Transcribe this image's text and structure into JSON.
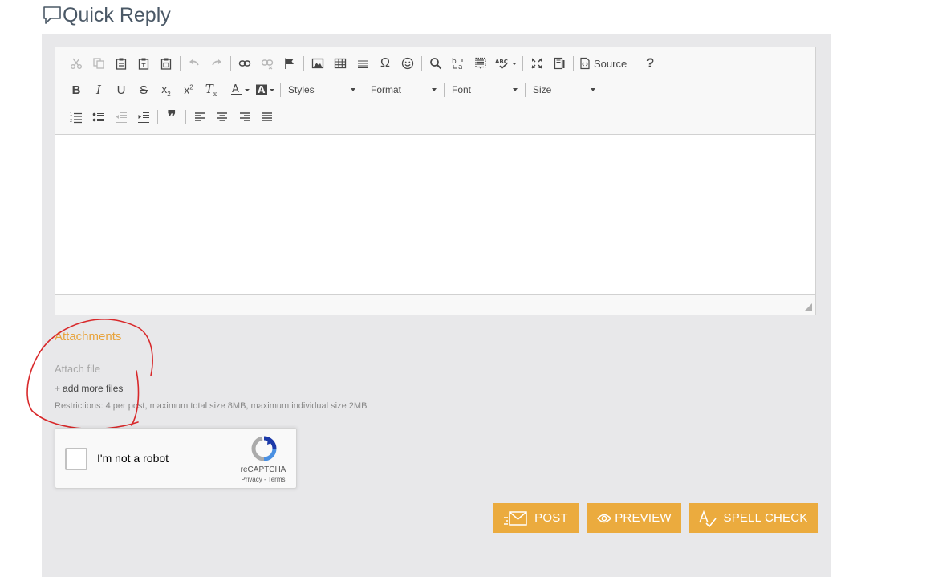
{
  "header": {
    "title": "Quick Reply",
    "icon": "speech-bubble-icon"
  },
  "toolbar": {
    "combos": {
      "styles": "Styles",
      "format": "Format",
      "font": "Font",
      "size": "Size"
    },
    "source_label": "Source",
    "help_label": "?",
    "special_char_label": "Ω",
    "blockquote_label": "❞"
  },
  "attachments": {
    "heading": "Attachments",
    "attach_file_label": "Attach file",
    "add_more_plus": "+",
    "add_more_label": "add more files",
    "restrictions": "Restrictions: 4 per post, maximum total size 8MB, maximum individual size 2MB"
  },
  "recaptcha": {
    "label": "I'm not a robot",
    "brand": "reCAPTCHA",
    "links": "Privacy - Terms"
  },
  "actions": {
    "post": "POST",
    "preview": "PREVIEW",
    "spell_check": "SPELL CHECK"
  },
  "colors": {
    "accent": "#ebab3e",
    "heading_accent": "#e8a33b",
    "panel_bg": "#e8e8ea",
    "annotation_red": "#d8282a"
  }
}
